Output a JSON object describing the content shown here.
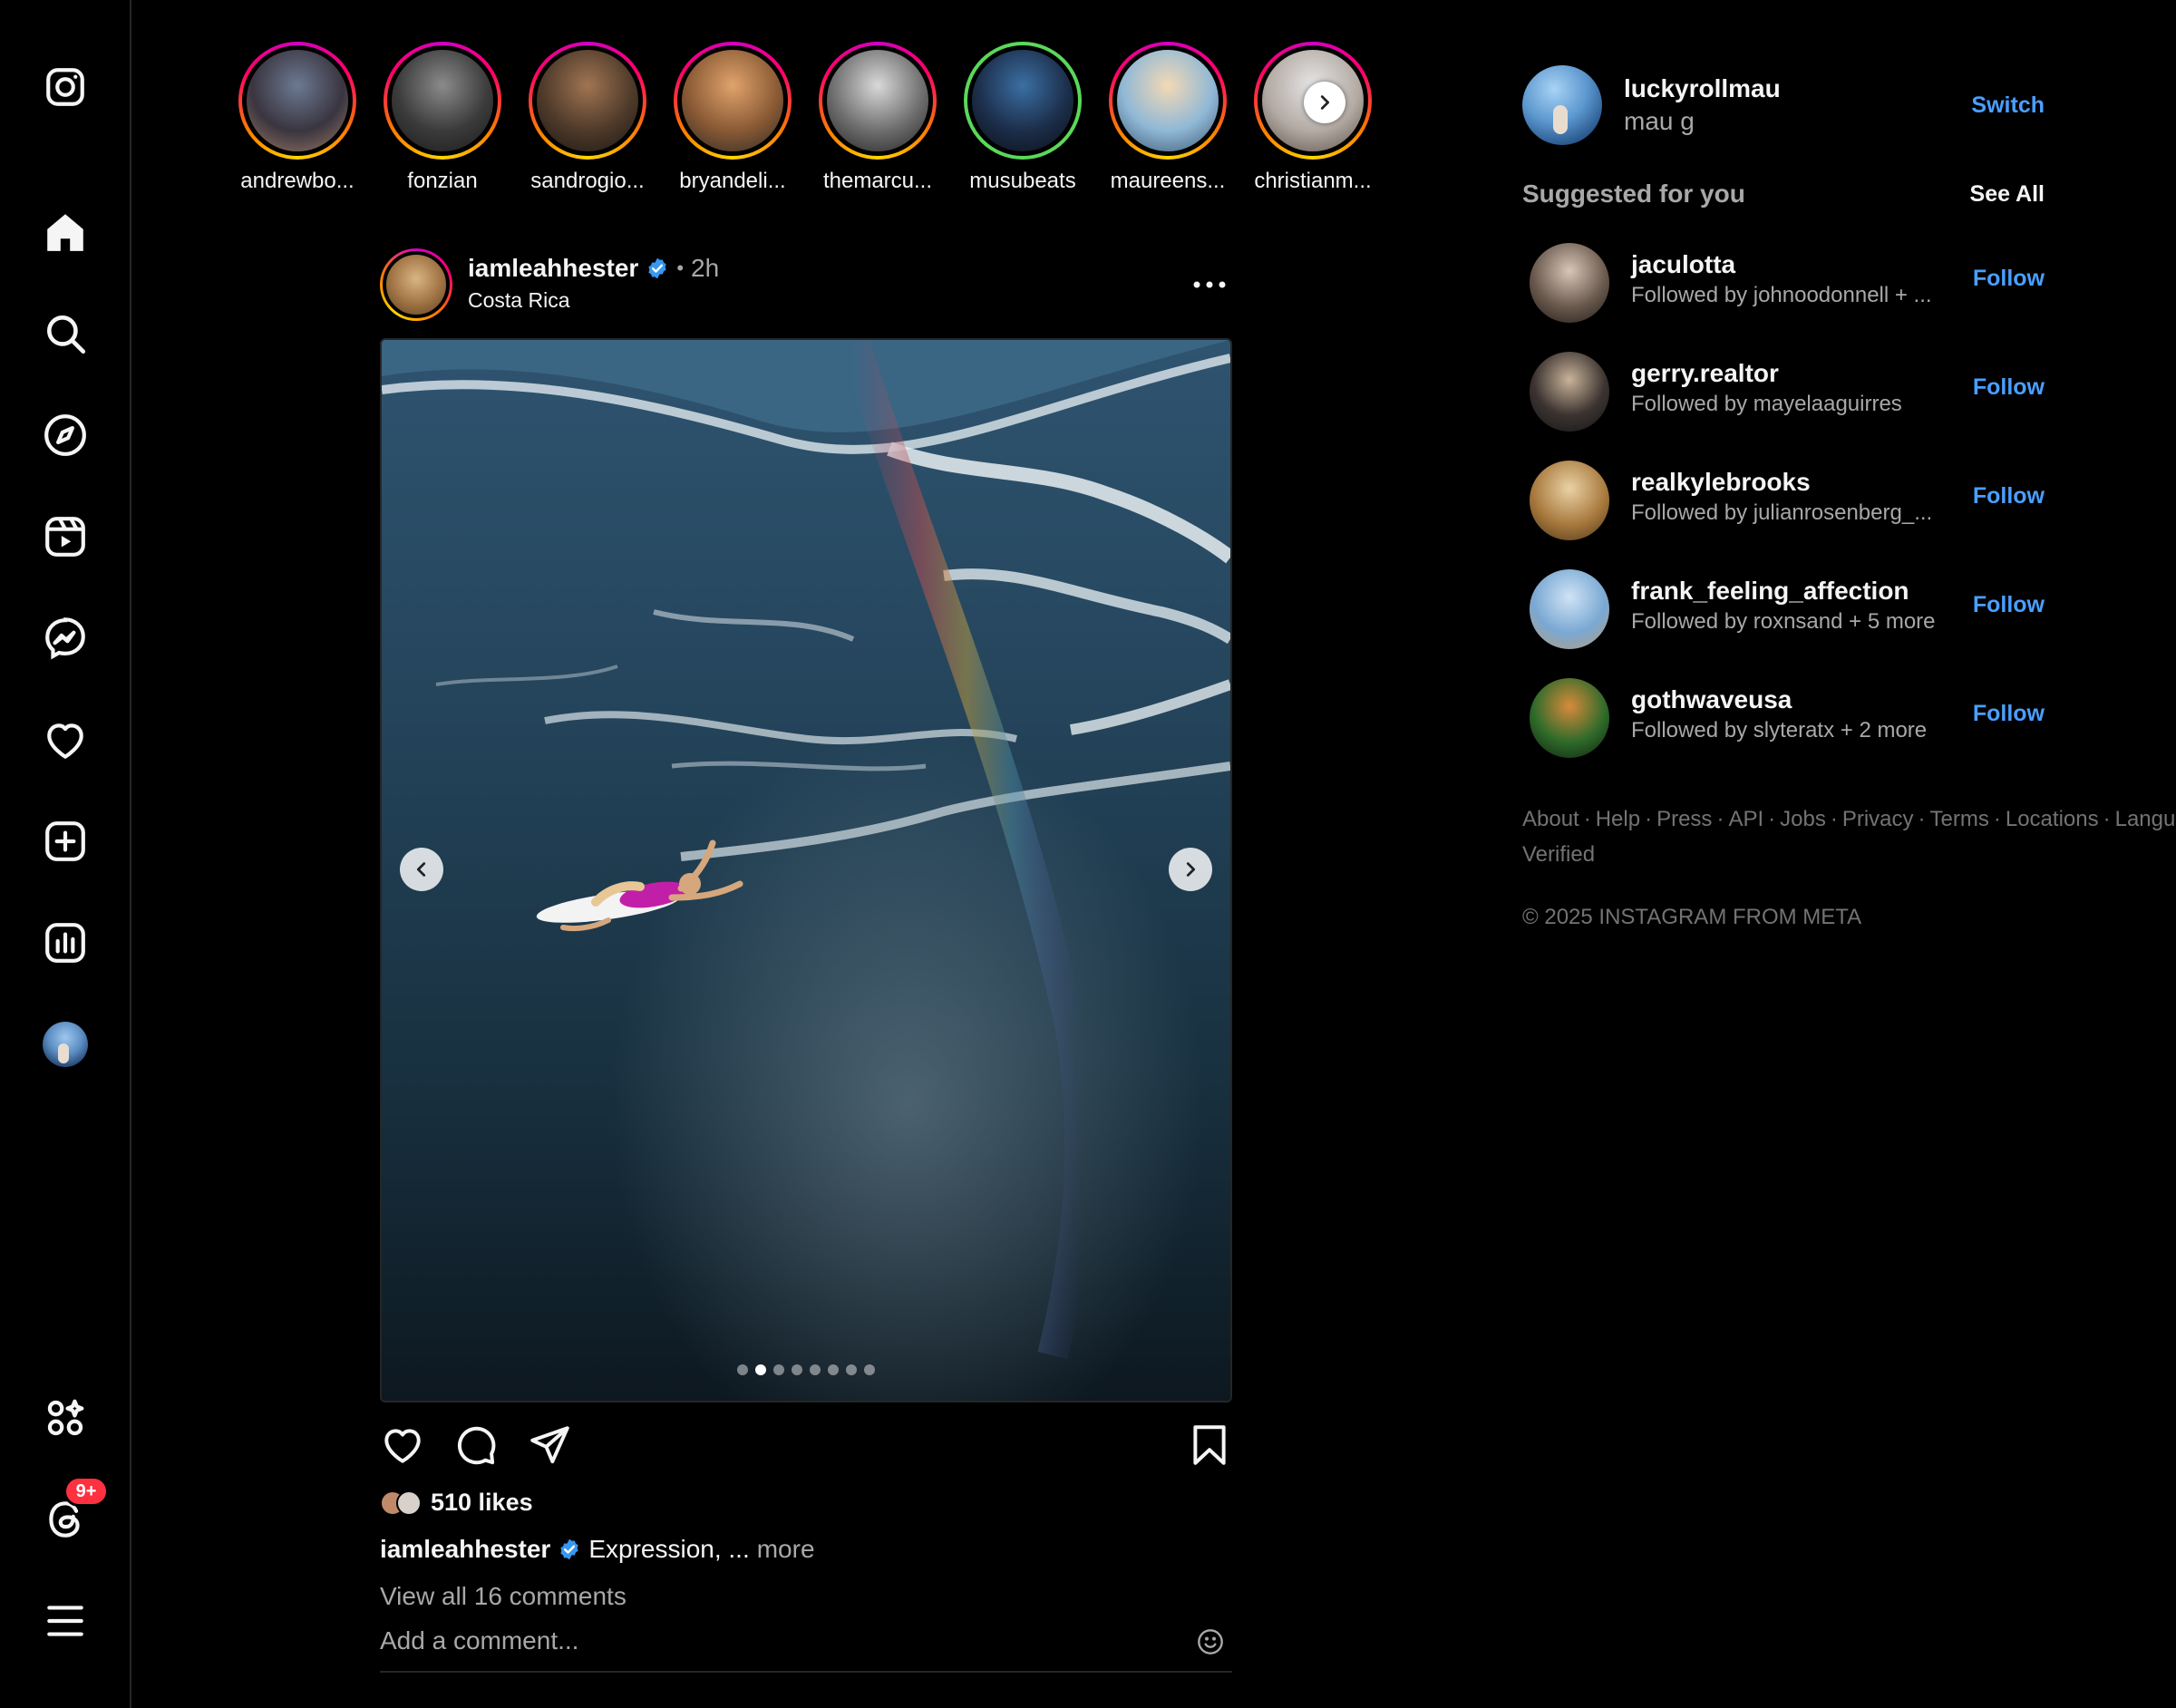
{
  "stories": [
    {
      "username": "andrewbo...",
      "ring": "gradient",
      "photo": [
        "#6c7a92",
        "#3a3540",
        "#9b7a63"
      ]
    },
    {
      "username": "fonzian",
      "ring": "gradient",
      "photo": [
        "#8b8b8b",
        "#3b3b3b",
        "#1a1a1a"
      ]
    },
    {
      "username": "sandrogio...",
      "ring": "gradient",
      "photo": [
        "#a07552",
        "#4e3a2a",
        "#1c1612"
      ]
    },
    {
      "username": "bryandeli...",
      "ring": "gradient",
      "photo": [
        "#e0a36c",
        "#8a5a35",
        "#2c2a24"
      ]
    },
    {
      "username": "themarcu...",
      "ring": "gradient",
      "photo": [
        "#d9d9d9",
        "#6e6e6e",
        "#222222"
      ]
    },
    {
      "username": "musubeats",
      "ring": "green",
      "photo": [
        "#3b6fa3",
        "#1c2e4a",
        "#0b0e16"
      ]
    },
    {
      "username": "maureens...",
      "ring": "gradient",
      "photo": [
        "#f3d9b5",
        "#8fb8d6",
        "#39536b"
      ]
    },
    {
      "username": "christianm...",
      "ring": "gradient",
      "photo": [
        "#e6e6e6",
        "#b3aaa3",
        "#5a4f48"
      ]
    }
  ],
  "post": {
    "username": "iamleahhester",
    "time": "2h",
    "location": "Costa Rica",
    "likes": "510 likes",
    "caption_text": "Expression, ...",
    "caption_more": "more",
    "view_comments": "View all 16 comments",
    "comment_placeholder": "Add a comment...",
    "carousel_total": 8,
    "carousel_active": 2
  },
  "me": {
    "username": "luckyrollmau",
    "name": "mau g",
    "switch_label": "Switch"
  },
  "suggested": {
    "title": "Suggested for you",
    "see_all": "See All",
    "follow_label": "Follow",
    "items": [
      {
        "username": "jaculotta",
        "subtitle": "Followed by johnoodonnell + ...",
        "photo": [
          "#d7c7b8",
          "#6b5a4e",
          "#1e1a18"
        ]
      },
      {
        "username": "gerry.realtor",
        "subtitle": "Followed by mayelaaguirres",
        "photo": [
          "#c9b39a",
          "#3b3330",
          "#141414"
        ]
      },
      {
        "username": "realkylebrooks",
        "subtitle": "Followed by julianrosenberg_...",
        "photo": [
          "#ead2a6",
          "#a97a3e",
          "#4b3419"
        ]
      },
      {
        "username": "frank_feeling_affection",
        "subtitle": "Followed by roxnsand + 5 more",
        "photo": [
          "#cfe3f5",
          "#7aa8d3",
          "#b99c78"
        ]
      },
      {
        "username": "gothwaveusa",
        "subtitle": "Followed by slyteratx + 2 more",
        "photo": [
          "#d98a3b",
          "#2f6b2a",
          "#0f1e0f"
        ]
      }
    ]
  },
  "footer": {
    "links": [
      "About",
      "Help",
      "Press",
      "API",
      "Jobs",
      "Privacy",
      "Terms",
      "Locations",
      "Language",
      "Meta Verified"
    ],
    "copyright": "© 2025 INSTAGRAM FROM META"
  },
  "nav": {
    "notification_badge": "9+"
  },
  "colors": {
    "accent_blue": "#4a9fff",
    "verified_blue": "#3897f0",
    "badge_red": "#ff3040",
    "background": "#000000"
  }
}
